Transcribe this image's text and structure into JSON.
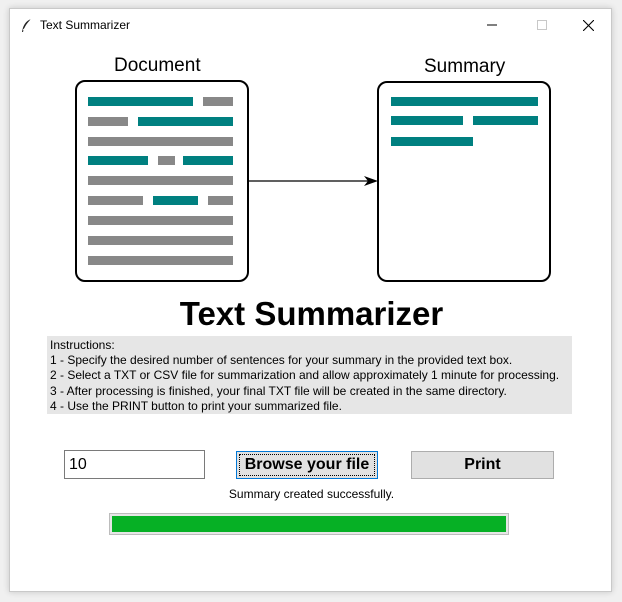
{
  "window": {
    "title": "Text Summarizer",
    "app_icon": "feather-icon",
    "controls": [
      "minimize-icon",
      "maximize-icon",
      "close-icon"
    ]
  },
  "illustration": {
    "document_label": "Document",
    "summary_label": "Summary",
    "colors": {
      "highlight": "#008080",
      "text_line": "#888888"
    }
  },
  "main": {
    "heading": "Text Summarizer",
    "instructions": [
      "Instructions:",
      "1 - Specify the desired number of sentences for your summary in the provided text box.",
      "2 - Select a TXT or CSV file for summarization and allow approximately 1 minute for processing.",
      "3 - After processing is finished, your final TXT file will be created in the same directory.",
      "4 - Use the PRINT button to print your summarized file."
    ],
    "sentence_count": "10",
    "browse_label": "Browse your file",
    "print_label": "Print",
    "status": "Summary created successfully.",
    "progress": 1.0,
    "progress_color": "#06b025"
  }
}
